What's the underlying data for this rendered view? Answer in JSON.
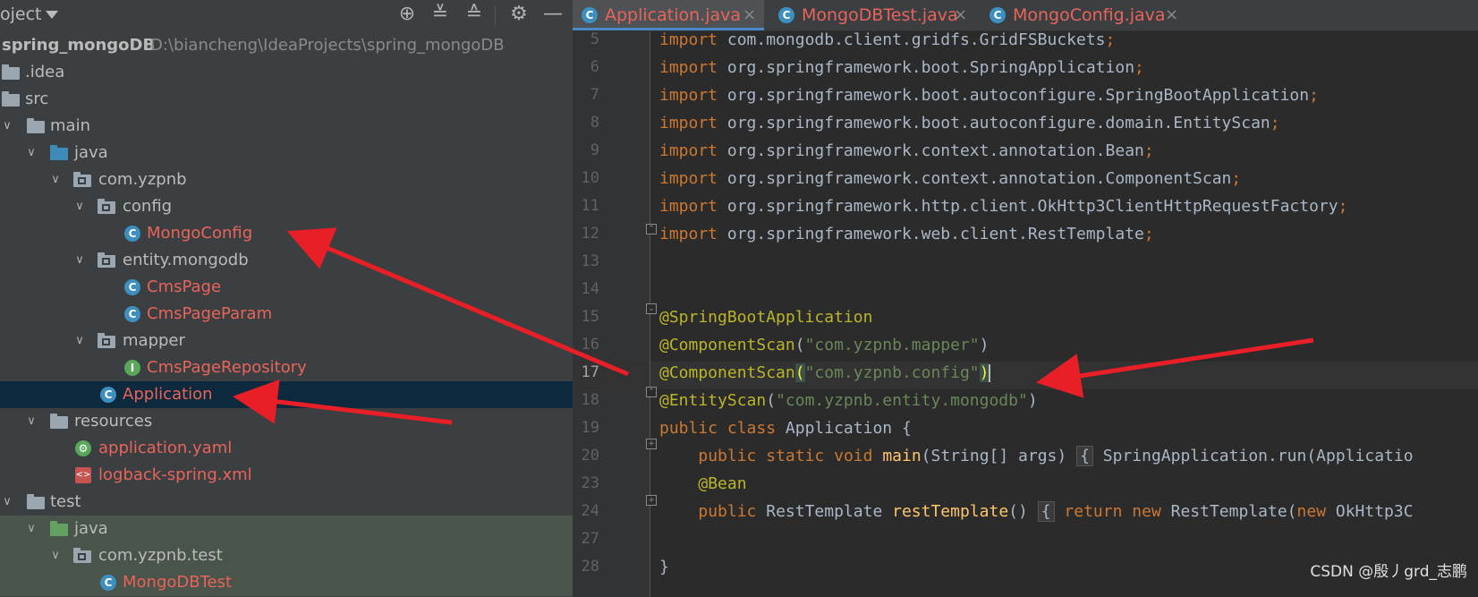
{
  "project_panel": {
    "title": "oject",
    "project_name": "spring_mongoDB",
    "project_path": "D:\\biancheng\\IdeaProjects\\spring_mongoDB",
    "toolbar_icons": [
      "locate-icon",
      "expand-all-icon",
      "collapse-all-icon",
      "gear-icon",
      "minimize-icon"
    ]
  },
  "tree": [
    {
      "label": "spring_mongoDB",
      "level": 0,
      "icon": "folder-icon"
    },
    {
      "label": ".idea",
      "level": 0,
      "icon": "folder-icon"
    },
    {
      "label": "src",
      "level": 0,
      "icon": "folder-icon"
    },
    {
      "label": "main",
      "level": 0,
      "icon": "folder-icon"
    },
    {
      "label": "java",
      "level": 1,
      "icon": "source-folder-icon"
    },
    {
      "label": "com.yzpnb",
      "level": 2,
      "icon": "package-icon"
    },
    {
      "label": "config",
      "level": 3,
      "icon": "package-icon"
    },
    {
      "label": "MongoConfig",
      "level": 4,
      "icon": "class-icon"
    },
    {
      "label": "entity.mongodb",
      "level": 3,
      "icon": "package-icon"
    },
    {
      "label": "CmsPage",
      "level": 4,
      "icon": "class-icon"
    },
    {
      "label": "CmsPageParam",
      "level": 4,
      "icon": "class-icon"
    },
    {
      "label": "mapper",
      "level": 3,
      "icon": "package-icon"
    },
    {
      "label": "CmsPageRepository",
      "level": 4,
      "icon": "interface-icon"
    },
    {
      "label": "Application",
      "level": 3,
      "icon": "spring-app-icon"
    },
    {
      "label": "resources",
      "level": 1,
      "icon": "resources-folder-icon"
    },
    {
      "label": "application.yaml",
      "level": 3,
      "icon": "yaml-icon"
    },
    {
      "label": "logback-spring.xml",
      "level": 3,
      "icon": "xml-icon"
    },
    {
      "label": "test",
      "level": 0,
      "icon": "folder-icon"
    },
    {
      "label": "java",
      "level": 1,
      "icon": "test-folder-icon"
    },
    {
      "label": "com.yzpnb.test",
      "level": 2,
      "icon": "package-icon"
    },
    {
      "label": "MongoDBTest",
      "level": 3,
      "icon": "class-icon"
    }
  ],
  "tabs": [
    {
      "label": "Application.java",
      "active": true
    },
    {
      "label": "MongoDBTest.java",
      "active": false
    },
    {
      "label": "MongoConfig.java",
      "active": false
    }
  ],
  "line_numbers": [
    "5",
    "6",
    "7",
    "8",
    "9",
    "10",
    "11",
    "12",
    "13",
    "14",
    "15",
    "16",
    "17",
    "18",
    "19",
    "20",
    "23",
    "24",
    "27",
    "28"
  ],
  "current_line": "17",
  "code": {
    "imp": "import",
    "l5": "com.mongodb.client.gridfs.GridFSBuckets",
    "l6": "org.springframework.boot.SpringApplication",
    "l7": "org.springframework.boot.autoconfigure.SpringBootApplication",
    "l8": "org.springframework.boot.autoconfigure.domain.EntityScan",
    "l9": "org.springframework.context.annotation.Bean",
    "l10": "org.springframework.context.annotation.ComponentScan",
    "l11": "org.springframework.http.client.OkHttp3ClientHttpRequestFactory",
    "l12": "org.springframework.web.client.RestTemplate",
    "semi": ";",
    "a_sba": "@SpringBootApplication",
    "a_cs": "@ComponentScan",
    "s_mapper": "\"com.yzpnb.mapper\"",
    "s_config": "\"com.yzpnb.config\"",
    "a_es": "@EntityScan",
    "s_entity": "\"com.yzpnb.entity.mongodb\"",
    "kw_public": "public",
    "kw_class": "class",
    "kw_static": "static",
    "kw_void": "void",
    "kw_return": "return",
    "kw_new": "new",
    "cls_app": "Application {",
    "l20_main": "main",
    "l20_args": "(String[] args)",
    "l20_body": "{",
    "l20_rest": "SpringApplication.run(Applicatio",
    "a_bean": "@Bean",
    "l24_type": "RestTemplate",
    "l24_fn": "restTemplate",
    "l24_parens": "()",
    "l24_new1": "RestTemplate(",
    "l24_new2": "OkHttp3C",
    "close_brace": "}"
  },
  "watermark": "CSDN @殷丿grd_志鹏"
}
